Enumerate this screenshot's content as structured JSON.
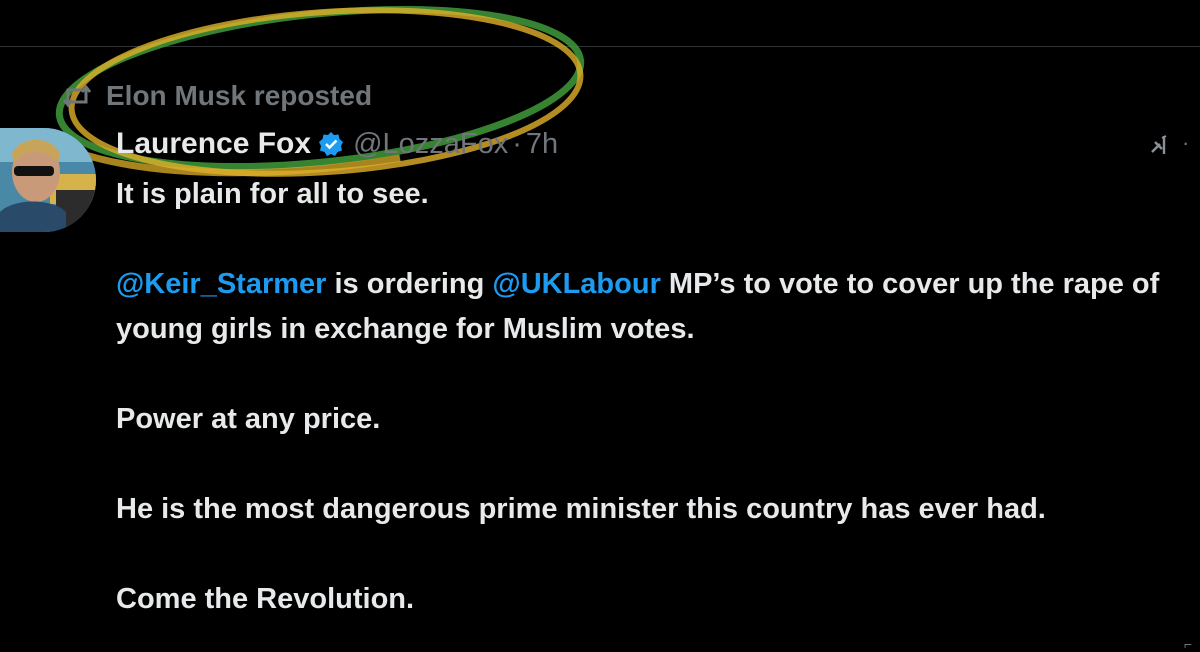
{
  "repost": {
    "icon": "repost-icon",
    "text": "Elon Musk reposted"
  },
  "tweet": {
    "author": {
      "display_name": "Laurence Fox",
      "verified_icon": "verified-badge-icon",
      "handle": "@LozzaFox",
      "separator": "·",
      "timestamp": "7h"
    },
    "line1": "It is plain for all to see.",
    "para2": {
      "mention1": "@Keir_Starmer",
      "text1": " is ordering ",
      "mention2": "@UKLabour",
      "text2": " MP’s to vote to cover up the rape of young girls in exchange for Muslim votes."
    },
    "line3": "Power at any price.",
    "line4": "He is the most dangerous prime minister this country has ever had.",
    "line5": "Come the Revolution."
  },
  "icons": {
    "grok": "grok-icon",
    "more": "more-options-icon"
  },
  "colors": {
    "background": "#000000",
    "text": "#e7e9ea",
    "secondary": "#71767b",
    "mention": "#1d9bf0",
    "verified": "#1d9bf0",
    "annotation_green": "#4caf50",
    "annotation_yellow": "#f2c230"
  }
}
